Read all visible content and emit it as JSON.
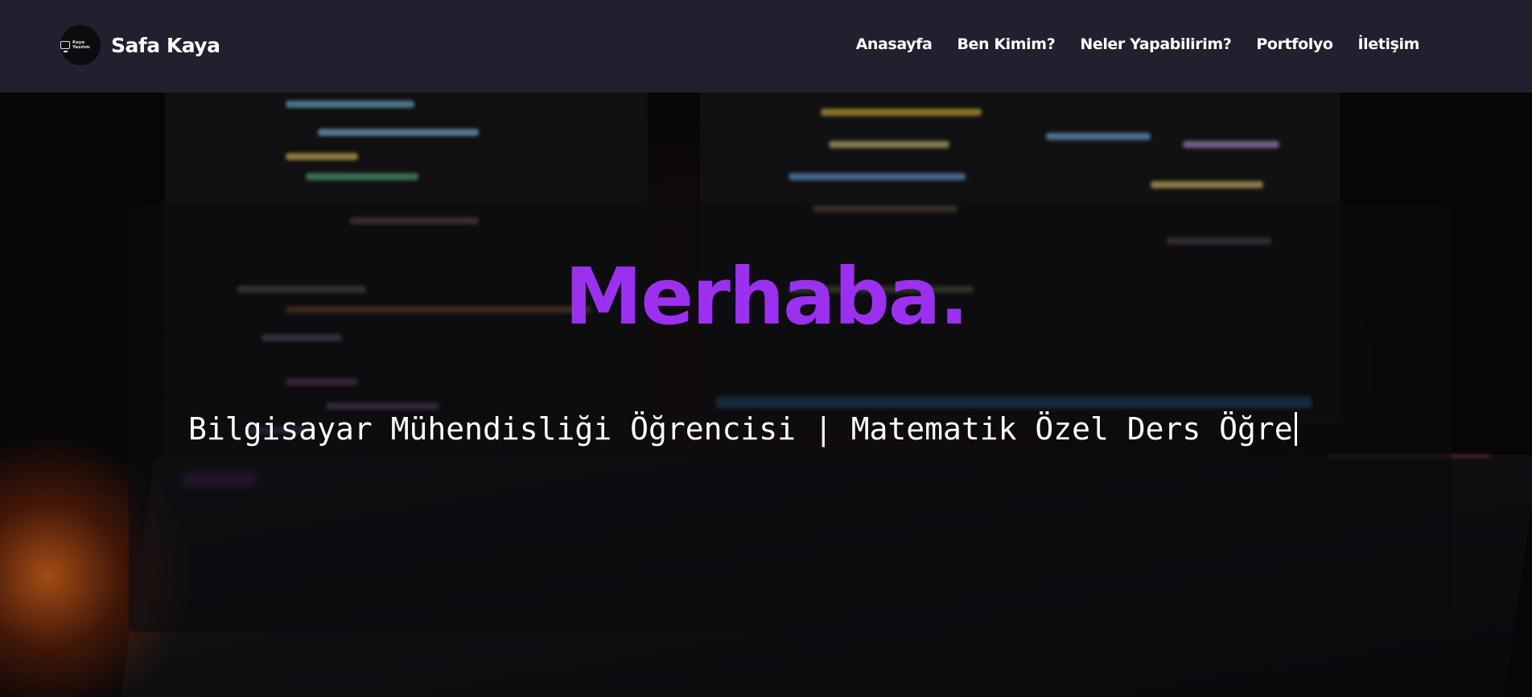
{
  "navbar": {
    "logo_text": "Kaya Yazılım",
    "brand": "Safa Kaya",
    "links": [
      "Anasayfa",
      "Ben Kimim?",
      "Neler Yapabilirim?",
      "Portfolyo",
      "İletişim"
    ]
  },
  "hero": {
    "title": "Merhaba.",
    "subtitle": "Bilgisayar Mühendisliği Öğrencisi | Matematik Özel Ders Öğre"
  },
  "colors": {
    "navbar_bg": "#20202f",
    "title_accent": "#9b30f0",
    "text": "#ffffff"
  },
  "icons": {
    "logo": "monitor-icon"
  }
}
